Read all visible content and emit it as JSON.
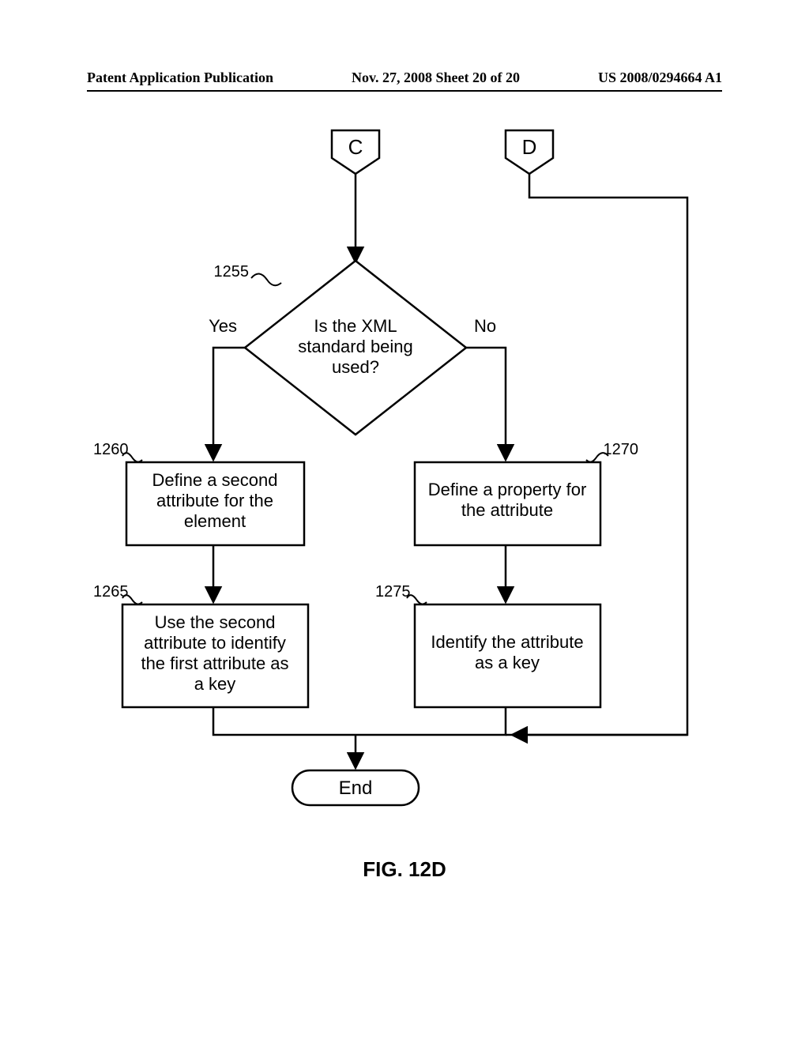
{
  "header": {
    "left": "Patent Application Publication",
    "center": "Nov. 27, 2008  Sheet 20 of 20",
    "right": "US 2008/0294664 A1"
  },
  "figure": {
    "caption": "FIG. 12D"
  },
  "connectors": {
    "c": "C",
    "d": "D"
  },
  "decision": {
    "ref": "1255",
    "line1": "Is the XML",
    "line2": "standard being",
    "line3": "used?",
    "yes": "Yes",
    "no": "No"
  },
  "box1260": {
    "ref": "1260",
    "line1": "Define a second",
    "line2": "attribute for the",
    "line3": "element"
  },
  "box1265": {
    "ref": "1265",
    "line1": "Use the second",
    "line2": "attribute to identify",
    "line3": "the first attribute as",
    "line4": "a key"
  },
  "box1270": {
    "ref": "1270",
    "line1": "Define a property for",
    "line2": "the attribute"
  },
  "box1275": {
    "ref": "1275",
    "line1": "Identify the attribute",
    "line2": "as a key"
  },
  "terminator": {
    "label": "End"
  }
}
